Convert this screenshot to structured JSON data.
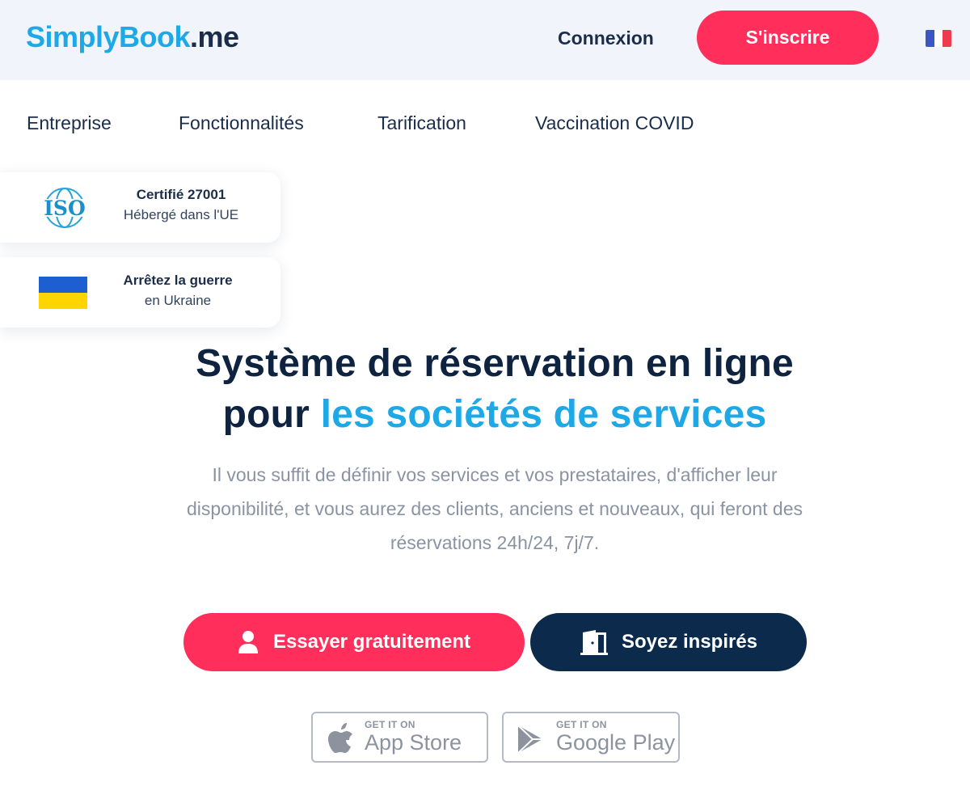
{
  "header": {
    "logo_part1": "SimplyBook",
    "logo_part2": ".me",
    "login_label": "Connexion",
    "signup_label": "S'inscrire",
    "language_flag": "flag-france-icon"
  },
  "nav": {
    "items": [
      {
        "label": "Entreprise"
      },
      {
        "label": "Fonctionnalités"
      },
      {
        "label": "Tarification"
      },
      {
        "label": "Vaccination COVID"
      }
    ]
  },
  "badges": [
    {
      "icon": "iso-icon",
      "icon_text": "ISO",
      "line1": "Certifié 27001",
      "line2": "Hébergé dans l'UE"
    },
    {
      "icon": "ukraine-flag-icon",
      "line1": "Arrêtez la guerre",
      "line2": "en Ukraine"
    }
  ],
  "hero": {
    "title_line1": "Système de réservation en ligne",
    "title_line2_prefix": "pour",
    "title_line2_accent": "les sociétés de services",
    "description": "Il vous suffit de définir vos services et vos prestataires, d'afficher leur disponibilité, et vous aurez des clients, anciens et nouveaux, qui feront des réservations 24h/24, 7j/7."
  },
  "cta": {
    "try_label": "Essayer gratuitement",
    "inspire_label": "Soyez inspirés"
  },
  "stores": [
    {
      "small": "GET IT ON",
      "big": "App Store",
      "icon": "apple-icon"
    },
    {
      "small": "GET IT ON",
      "big": "Google Play",
      "icon": "google-play-icon"
    }
  ],
  "colors": {
    "brand_blue": "#1ea9e6",
    "brand_navy": "#0d2340",
    "accent_red": "#ff2e5b",
    "button_navy": "#0c2a4b",
    "topbar_bg": "#f1f5fb"
  }
}
